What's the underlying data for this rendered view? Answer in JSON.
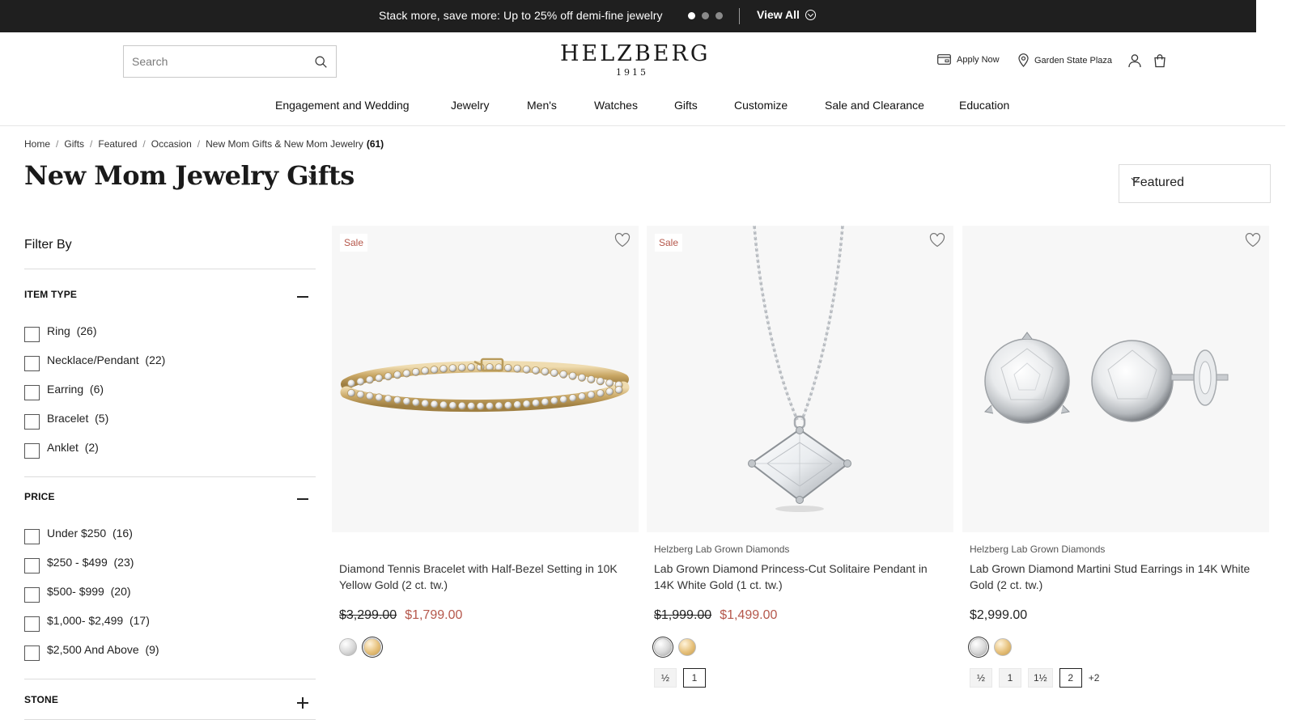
{
  "promo": {
    "text": "Stack more, save more: Up to 25% off demi-fine jewelry",
    "view_all": "View All",
    "slide_count": 3,
    "active_slide": 1
  },
  "search": {
    "placeholder": "Search"
  },
  "logo": {
    "name": "HELZBERG",
    "year": "1915"
  },
  "header_links": {
    "apply_now": "Apply Now",
    "store": "Garden State Plaza"
  },
  "icons": [
    "search-icon",
    "credit-card-icon",
    "location-pin-icon",
    "account-icon",
    "cart-icon",
    "heart-icon",
    "chevron-down-icon",
    "minus-icon",
    "plus-icon"
  ],
  "nav": [
    "Engagement and Wedding",
    "Jewelry",
    "Men's",
    "Watches",
    "Gifts",
    "Customize",
    "Sale and Clearance",
    "Education"
  ],
  "breadcrumb": {
    "items": [
      "Home",
      "Gifts",
      "Featured",
      "Occasion",
      "New Mom Gifts & New Mom Jewelry"
    ],
    "count": "(61)"
  },
  "page_title": "New Mom Jewelry Gifts",
  "sort": {
    "selected": "Featured"
  },
  "filters": {
    "title": "Filter By",
    "groups": [
      {
        "name": "ITEM TYPE",
        "expanded": true,
        "options": [
          {
            "label": "Ring",
            "count": "(26)"
          },
          {
            "label": "Necklace/Pendant",
            "count": "(22)"
          },
          {
            "label": "Earring",
            "count": "(6)"
          },
          {
            "label": "Bracelet",
            "count": "(5)"
          },
          {
            "label": "Anklet",
            "count": "(2)"
          }
        ]
      },
      {
        "name": "PRICE",
        "expanded": true,
        "options": [
          {
            "label": "Under $250",
            "count": "(16)"
          },
          {
            "label": "$250 - $499",
            "count": "(23)"
          },
          {
            "label": "$500- $999",
            "count": "(20)"
          },
          {
            "label": "$1,000- $2,499",
            "count": "(17)"
          },
          {
            "label": "$2,500 And Above",
            "count": "(9)"
          }
        ]
      },
      {
        "name": "STONE",
        "expanded": false,
        "options": []
      }
    ]
  },
  "products": [
    {
      "sale_tag": "Sale",
      "brand": "",
      "name": "Diamond Tennis Bracelet with Half-Bezel Setting in 10K Yellow Gold (2 ct. tw.)",
      "price_original": "$3,299.00",
      "price_sale": "$1,799.00",
      "price": "",
      "swatches": [
        {
          "metal": "white gold",
          "color": "#d9d9d9",
          "selected": false
        },
        {
          "metal": "yellow gold",
          "color": "#e6c07a",
          "selected": true
        }
      ],
      "sizes": []
    },
    {
      "sale_tag": "Sale",
      "brand": "Helzberg Lab Grown Diamonds",
      "name": "Lab Grown Diamond Princess-Cut Solitaire Pendant in 14K White Gold (1 ct. tw.)",
      "price_original": "$1,999.00",
      "price_sale": "$1,499.00",
      "price": "",
      "swatches": [
        {
          "metal": "white gold",
          "color": "#d9d9d9",
          "selected": true
        },
        {
          "metal": "yellow gold",
          "color": "#e6c07a",
          "selected": false
        }
      ],
      "sizes": [
        {
          "label": "½",
          "selected": false
        },
        {
          "label": "1",
          "selected": true
        }
      ],
      "sizes_more": ""
    },
    {
      "sale_tag": "",
      "brand": "Helzberg Lab Grown Diamonds",
      "name": "Lab Grown Diamond Martini Stud Earrings in 14K White Gold (2 ct. tw.)",
      "price_original": "",
      "price_sale": "",
      "price": "$2,999.00",
      "swatches": [
        {
          "metal": "white gold",
          "color": "#d9d9d9",
          "selected": true
        },
        {
          "metal": "yellow gold",
          "color": "#e6c07a",
          "selected": false
        }
      ],
      "sizes": [
        {
          "label": "½",
          "selected": false
        },
        {
          "label": "1",
          "selected": false
        },
        {
          "label": "1½",
          "selected": false
        },
        {
          "label": "2",
          "selected": true
        }
      ],
      "sizes_more": "+2"
    }
  ],
  "colors": {
    "promo_bg": "#1f1f1f",
    "sale_red": "#b5574b",
    "text_dark": "#222222",
    "image_bg": "#f7f7f7"
  }
}
